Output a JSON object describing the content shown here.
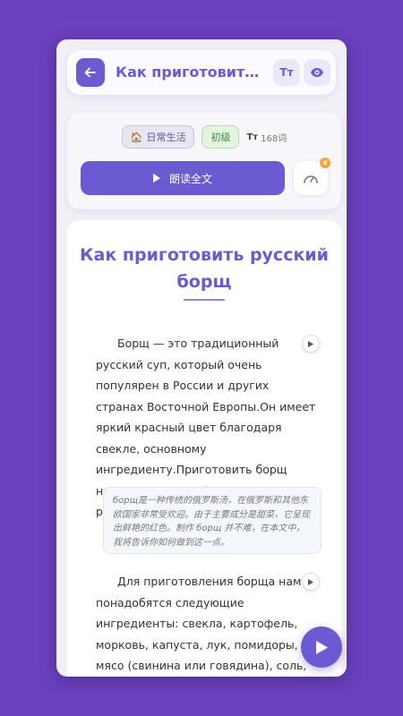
{
  "header": {
    "title": "Как приготовить р...",
    "font_button_label": "Tт"
  },
  "meta": {
    "category_emoji": "🏠",
    "category": "日常生活",
    "level": "初级",
    "word_count_icon": "Tт",
    "word_count": "168词",
    "read_all_label": "朗读全文",
    "speed_badge": "♛"
  },
  "article": {
    "title": "Как приготовить русский борщ",
    "paragraph1": "Борщ — это традиционный русский суп, который очень популярен в России и других странах Восточной Европы.Он имеет яркий красный цвет благодаря свекле, основному ингредиенту.Приготовить борщ несложно, и в этой статье я расскажу, как это сделать.",
    "translation1": "борщ是一种传统的俄罗斯汤，在俄罗斯和其他东欧国家非常受欢迎。由于主要成分是甜菜，它呈现出鲜艳的红色。制作 борщ 并不难，在本文中，我将告诉你如何做到这一点。",
    "paragraph2": "Для приготовления борща нам понадобятся следующие ингредиенты: свекла, картофель, морковь, капуста, лук, помидоры, мясо (свинина или говядина), соль, перец и зелень.Выбор мяса зависит от вашего вкуса.Также"
  },
  "colors": {
    "background": "#6b3fbf",
    "accent": "#6b5bd3",
    "level_green": "#3f8a38",
    "badge_orange": "#f2a53a"
  },
  "icons": [
    "arrow-left-icon",
    "font-size-icon",
    "eye-icon",
    "house-icon",
    "play-icon",
    "speedometer-icon",
    "crown-icon"
  ]
}
